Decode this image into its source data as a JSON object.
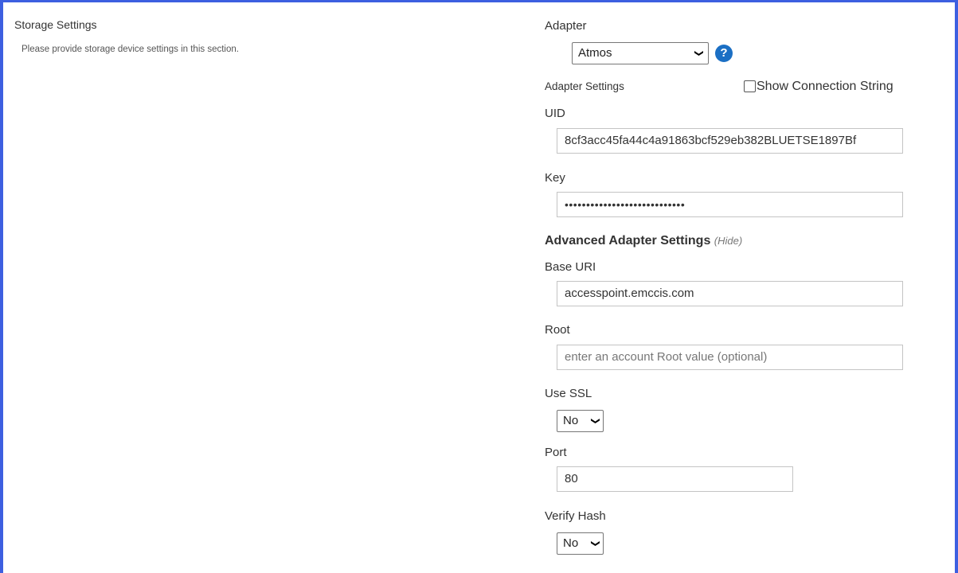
{
  "section": {
    "title": "Storage Settings",
    "description": "Please provide storage device settings in this section."
  },
  "adapter": {
    "label": "Adapter",
    "selected": "Atmos",
    "help_icon": "question-circle-icon",
    "help_glyph": "?"
  },
  "adapter_settings": {
    "label": "Adapter Settings",
    "show_connection_string": "Show Connection String",
    "uid_label": "UID",
    "uid_value": "8cf3acc45fa44c4a91863bcf529eb382BLUETSE1897Bf",
    "key_label": "Key",
    "key_value": "••••••••••••••••••••••••••••"
  },
  "advanced": {
    "title": "Advanced Adapter Settings",
    "hide_link": "(Hide)",
    "base_uri_label": "Base URI",
    "base_uri_value": "accesspoint.emccis.com",
    "root_label": "Root",
    "root_placeholder": "enter an account Root value (optional)",
    "use_ssl_label": "Use SSL",
    "use_ssl_value": "No",
    "port_label": "Port",
    "port_value": "80",
    "verify_hash_label": "Verify Hash",
    "verify_hash_value": "No"
  },
  "colors": {
    "frame": "#3d5fe0",
    "help_icon_bg": "#1b6fc4"
  }
}
